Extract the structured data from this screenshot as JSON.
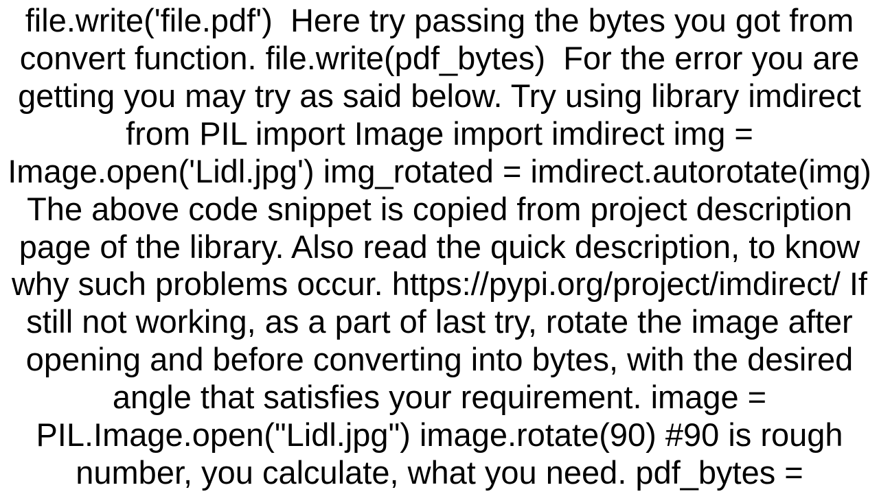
{
  "content": {
    "body_text": "file.write('file.pdf')  Here try passing the bytes you got from convert function. file.write(pdf_bytes)  For the error you are getting you may try as said below. Try using library imdirect from PIL import Image import imdirect img = Image.open('Lidl.jpg') img_rotated = imdirect.autorotate(img)  The above code snippet is copied from project description page of the library. Also read the quick description, to know why such problems occur. https://pypi.org/project/imdirect/ If still not working, as a part of last try, rotate the image after opening and before converting into bytes, with the desired angle that satisfies your requirement. image = PIL.Image.open(\"Lidl.jpg\") image.rotate(90) #90 is rough number, you calculate, what you need. pdf_bytes ="
  }
}
